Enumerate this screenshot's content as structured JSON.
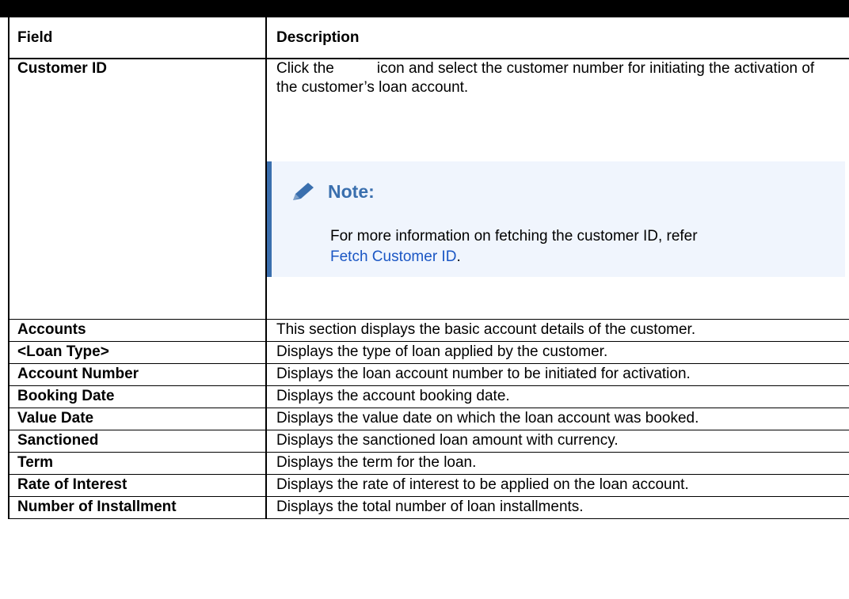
{
  "table": {
    "headers": {
      "field": "Field",
      "description": "Description"
    },
    "customer_id": {
      "field": "Customer ID",
      "desc_before_icon": "Click the",
      "desc_after_icon": "icon and select the customer number for initiating the activation of the customer’s loan account.",
      "icon": "search-icon",
      "note": {
        "icon": "pencil-icon",
        "title": "Note:",
        "text": "For more information on fetching the customer ID, refer",
        "link": "Fetch Customer ID",
        "after_link": "."
      }
    },
    "rows": [
      {
        "field": "Accounts",
        "description": "This section displays the basic account details of the customer."
      },
      {
        "field": "<Loan Type>",
        "description": "Displays the type of loan applied by the customer."
      },
      {
        "field": "Account Number",
        "description": "Displays the loan account number to be initiated for activation."
      },
      {
        "field": "Booking Date",
        "description": "Displays the account booking date."
      },
      {
        "field": "Value Date",
        "description": "Displays the value date on which the loan account was booked."
      },
      {
        "field": "Sanctioned",
        "description": "Displays the sanctioned loan amount with currency."
      },
      {
        "field": "Term",
        "description": "Displays the term for the loan."
      },
      {
        "field": "Rate of Interest",
        "description": "Displays the rate of interest to be applied on the loan account."
      },
      {
        "field": "Number of Installment",
        "description": "Displays the total number of loan installments."
      }
    ]
  },
  "colors": {
    "note_accent": "#3a6fae",
    "note_background": "#f0f5fd",
    "link": "#1a56c4"
  }
}
